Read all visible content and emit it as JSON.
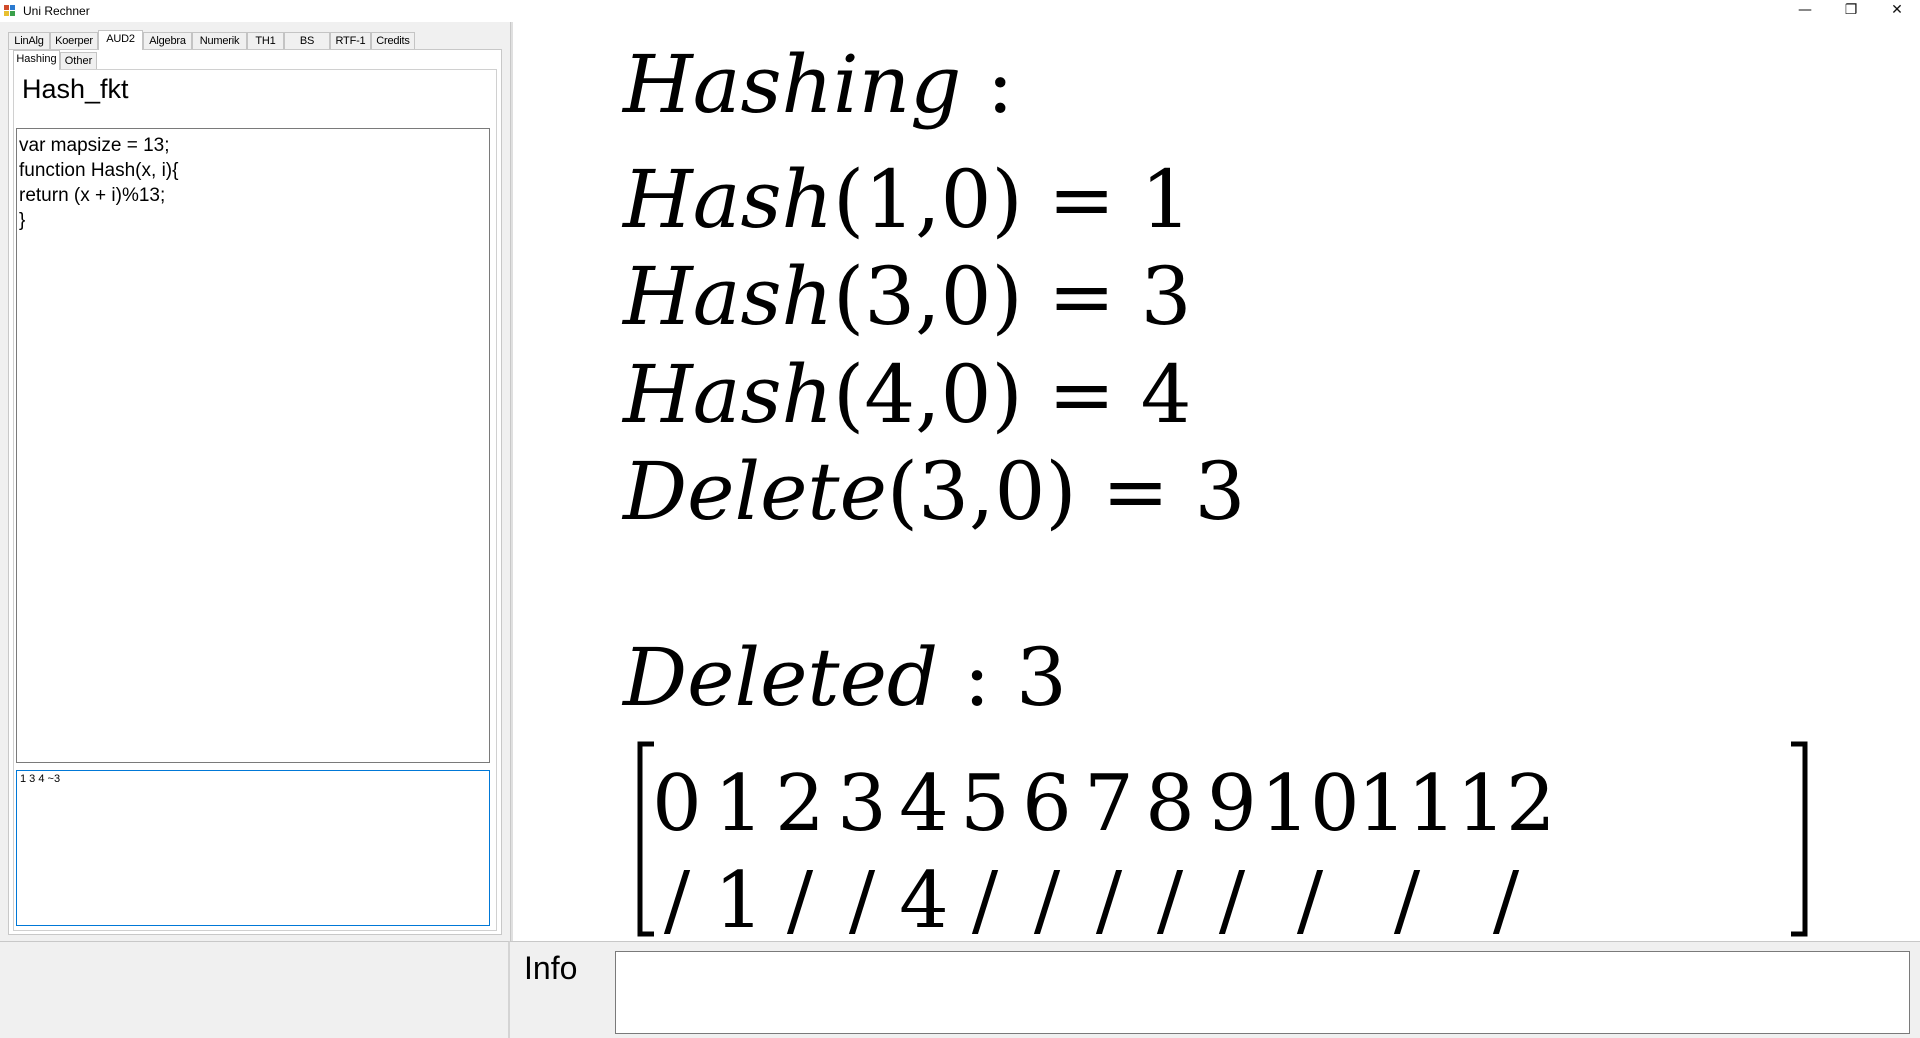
{
  "window": {
    "title": "Uni Rechner",
    "minimize_icon": "minimize-icon",
    "maximize_icon": "restore-icon",
    "close_icon": "close-icon"
  },
  "tabs": [
    "LinAlg",
    "Koerper",
    "AUD2",
    "Algebra",
    "Numerik",
    "TH1",
    "BS",
    "RTF-1",
    "Credits"
  ],
  "active_tab": "AUD2",
  "subtabs": [
    "Hashing",
    "Other"
  ],
  "active_subtab": "Hashing",
  "hashing": {
    "function_label": "Hash_fkt",
    "code": "var mapsize = 13;\nfunction Hash(x, i){\nreturn (x + i)%13;\n}",
    "input": "1 3 4 ~3"
  },
  "output": {
    "heading": "Hashing",
    "lines": [
      {
        "fn": "Hash",
        "args": "(1,0)",
        "result": "1"
      },
      {
        "fn": "Hash",
        "args": "(3,0)",
        "result": "3"
      },
      {
        "fn": "Hash",
        "args": "(4,0)",
        "result": "4"
      },
      {
        "fn": "Delete",
        "args": "(3,0)",
        "result": "3"
      }
    ],
    "deleted_label": "Deleted",
    "deleted_value": "3",
    "table_indices": [
      "0",
      "1",
      "2",
      "3",
      "4",
      "5",
      "6",
      "7",
      "8",
      "9",
      "10",
      "11",
      "12"
    ],
    "table_values": [
      "/",
      "1",
      "/",
      "/",
      "4",
      "/",
      "/",
      "/",
      "/",
      "/",
      "/",
      "/",
      "/"
    ]
  },
  "info": {
    "label": "Info",
    "text": ""
  }
}
